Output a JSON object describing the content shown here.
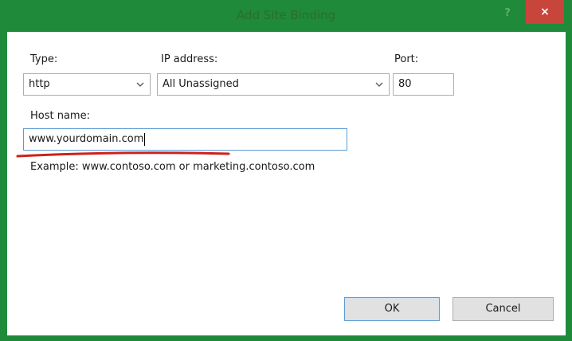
{
  "window": {
    "title": "Add Site Binding",
    "help_label": "?",
    "close_label": "×"
  },
  "form": {
    "type_label": "Type:",
    "type_value": "http",
    "ip_label": "IP address:",
    "ip_value": "All Unassigned",
    "port_label": "Port:",
    "port_value": "80",
    "host_label": "Host name:",
    "host_value": "www.yourdomain.com",
    "example_text": "Example: www.contoso.com or marketing.contoso.com"
  },
  "buttons": {
    "ok_label": "OK",
    "cancel_label": "Cancel"
  },
  "colors": {
    "titlebar": "#1e8a3a",
    "close": "#c7453b",
    "annotation": "#d0201b"
  }
}
